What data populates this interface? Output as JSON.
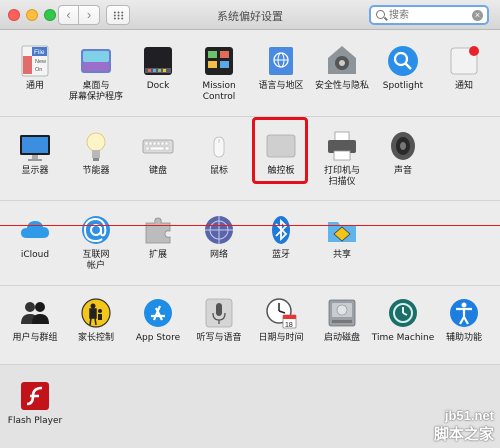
{
  "window": {
    "title": "系统偏好设置"
  },
  "search": {
    "placeholder": "搜索",
    "clear_glyph": "×"
  },
  "nav": {
    "back_glyph": "‹",
    "forward_glyph": "›"
  },
  "sections": {
    "personal": [
      {
        "id": "general",
        "label": [
          "通用"
        ],
        "icon": "general-icon"
      },
      {
        "id": "desktop",
        "label": [
          "桌面与",
          "屏幕保护程序"
        ],
        "icon": "desktop-screensaver-icon"
      },
      {
        "id": "dock",
        "label": [
          "Dock"
        ],
        "icon": "dock-icon"
      },
      {
        "id": "mission",
        "label": [
          "Mission",
          "Control"
        ],
        "icon": "mission-control-icon"
      },
      {
        "id": "language",
        "label": [
          "语言与地区"
        ],
        "icon": "language-region-icon"
      },
      {
        "id": "security",
        "label": [
          "安全性与隐私"
        ],
        "icon": "security-privacy-icon"
      },
      {
        "id": "spotlight",
        "label": [
          "Spotlight"
        ],
        "icon": "spotlight-icon"
      },
      {
        "id": "notifications",
        "label": [
          "通知"
        ],
        "icon": "notifications-icon"
      }
    ],
    "hardware": [
      {
        "id": "displays",
        "label": [
          "显示器"
        ],
        "icon": "displays-icon"
      },
      {
        "id": "energy",
        "label": [
          "节能器"
        ],
        "icon": "energy-saver-icon"
      },
      {
        "id": "keyboard",
        "label": [
          "键盘"
        ],
        "icon": "keyboard-icon"
      },
      {
        "id": "mouse",
        "label": [
          "鼠标"
        ],
        "icon": "mouse-icon"
      },
      {
        "id": "trackpad",
        "label": [
          "触控板"
        ],
        "icon": "trackpad-icon"
      },
      {
        "id": "printers",
        "label": [
          "打印机与",
          "扫描仪"
        ],
        "icon": "printers-scanners-icon"
      },
      {
        "id": "sound",
        "label": [
          "声音"
        ],
        "icon": "sound-icon"
      }
    ],
    "internet": [
      {
        "id": "icloud",
        "label": [
          "iCloud"
        ],
        "icon": "icloud-icon"
      },
      {
        "id": "accounts",
        "label": [
          "互联网",
          "帐户"
        ],
        "icon": "internet-accounts-icon"
      },
      {
        "id": "extensions",
        "label": [
          "扩展"
        ],
        "icon": "extensions-icon"
      },
      {
        "id": "network",
        "label": [
          "网络"
        ],
        "icon": "network-icon"
      },
      {
        "id": "bluetooth",
        "label": [
          "蓝牙"
        ],
        "icon": "bluetooth-icon"
      },
      {
        "id": "sharing",
        "label": [
          "共享"
        ],
        "icon": "sharing-icon"
      }
    ],
    "system": [
      {
        "id": "users",
        "label": [
          "用户与群组"
        ],
        "icon": "users-groups-icon"
      },
      {
        "id": "parental",
        "label": [
          "家长控制"
        ],
        "icon": "parental-controls-icon"
      },
      {
        "id": "appstore",
        "label": [
          "App Store"
        ],
        "icon": "app-store-icon"
      },
      {
        "id": "dictation",
        "label": [
          "听写与语音"
        ],
        "icon": "dictation-speech-icon"
      },
      {
        "id": "datetime",
        "label": [
          "日期与时间"
        ],
        "icon": "date-time-icon"
      },
      {
        "id": "startup",
        "label": [
          "启动磁盘"
        ],
        "icon": "startup-disk-icon"
      },
      {
        "id": "timemachine",
        "label": [
          "Time Machine"
        ],
        "icon": "time-machine-icon"
      },
      {
        "id": "accessibility",
        "label": [
          "辅助功能"
        ],
        "icon": "accessibility-icon"
      }
    ],
    "other": [
      {
        "id": "flash",
        "label": [
          "Flash Player"
        ],
        "icon": "flash-player-icon"
      }
    ]
  },
  "icon_texts": {
    "file": "File",
    "new": "New",
    "one": "On",
    "calendar_day": "18"
  },
  "highlighted_item": "trackpad",
  "watermark": {
    "url": "jb51.net",
    "text": "脚本之家"
  },
  "colors": {
    "highlight": "#e3111a",
    "search_focus": "#6fa7e8",
    "annotation_line": "#e21c1c"
  }
}
